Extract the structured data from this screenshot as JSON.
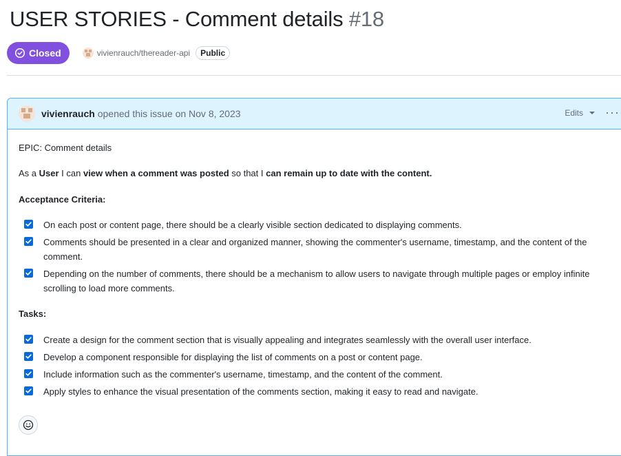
{
  "issue": {
    "title": "USER STORIES - Comment details",
    "number": "#18",
    "state": "Closed",
    "repo": "vivienrauch/thereader-api",
    "visibility": "Public"
  },
  "comment": {
    "author": "vivienrauch",
    "action": " opened this issue on Nov 8, 2023",
    "edits_label": "Edits",
    "more_label": "···",
    "epic": "EPIC: Comment details",
    "story": {
      "t1": "As a ",
      "b1": "User",
      "t2": " I can ",
      "b2": "view when a comment was posted",
      "t3": " so that I ",
      "b3": "can remain up to date with the content."
    },
    "criteria_heading": "Acceptance Criteria:",
    "criteria": [
      "On each post or content page, there should be a clearly visible section dedicated to displaying comments.",
      "Comments should be presented in a clear and organized manner, showing the commenter's username, timestamp, and the content of the comment.",
      "Depending on the number of comments, there should be a mechanism to allow users to navigate through multiple pages or employ infinite scrolling to load more comments."
    ],
    "tasks_heading": "Tasks:",
    "tasks": [
      "Create a design for the comment section that is visually appealing and integrates seamlessly with the overall user interface.",
      "Develop a component responsible for displaying the list of comments on a post or content page.",
      "Include information such as the commenter's username, timestamp, and the content of the comment.",
      "Apply styles to enhance the visual presentation of the comments section, making it easy to read and navigate."
    ],
    "criteria_checked": [
      true,
      true,
      true
    ],
    "tasks_checked": [
      true,
      true,
      true,
      true
    ]
  },
  "icons": {
    "state": "check-circle-icon",
    "checkbox": "checkbox-checked-icon",
    "reaction": "smiley-icon",
    "menu": "kebab-horizontal-icon",
    "dropdown": "triangle-down-icon"
  },
  "colors": {
    "closed_badge": "#8250df",
    "header_bg": "#ddf4ff",
    "header_border": "#54aeff",
    "checkbox": "#0969da"
  }
}
